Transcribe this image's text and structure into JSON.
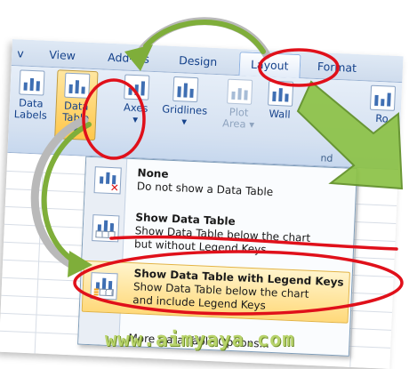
{
  "ribbon_tabs": [
    "v",
    "View",
    "Add-Ins",
    "Design",
    "Layout",
    "Format"
  ],
  "active_tab": "Layout",
  "ribbon_buttons": {
    "data_labels": [
      "Data",
      "Labels"
    ],
    "data_table": [
      "Data",
      "Table ▾"
    ],
    "axes": [
      "Axes",
      "▾"
    ],
    "gridlines": [
      "Gridlines",
      "▾"
    ],
    "plot_area": [
      "Plot",
      "Area ▾"
    ],
    "wall": "Wall",
    "ro": "Ro",
    "group_partial": "nd"
  },
  "menu": {
    "items": [
      {
        "title": "None",
        "desc": [
          "Do not show a Data Table"
        ],
        "icon": "data-table-none-icon"
      },
      {
        "title": "Show Data Table",
        "desc": [
          "Show Data Table below the chart",
          "but without Legend Keys"
        ],
        "icon": "data-table-icon"
      },
      {
        "title": "Show Data Table with Legend Keys",
        "desc": [
          "Show Data Table below the chart",
          "and include Legend Keys"
        ],
        "icon": "data-table-legend-keys-icon"
      }
    ],
    "more_options": "More Data Table Options..."
  },
  "highlighted_item": "Show Data Table with Legend Keys",
  "watermark": "www.aimyaya.com",
  "colors": {
    "annotation_red": "#e0101a",
    "arrow_green": "#7fae3a",
    "highlight": "#ffd97a",
    "ribbon_blue": "#d5e1f1"
  }
}
